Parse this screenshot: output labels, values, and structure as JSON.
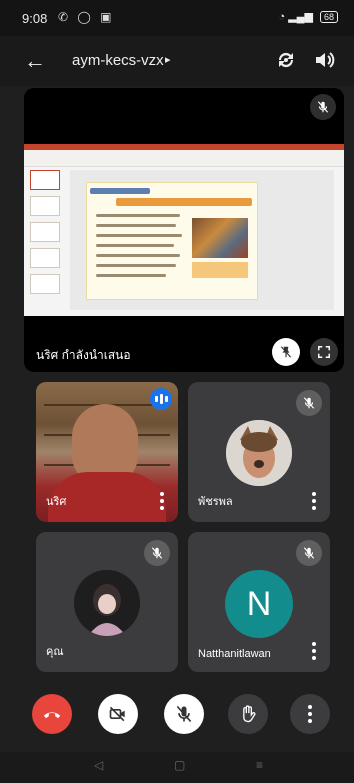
{
  "status_bar": {
    "time": "9:08",
    "battery": "68"
  },
  "header": {
    "meeting_code": "aym-kecs-vzx",
    "caret": "▸"
  },
  "presentation": {
    "presenter_label": "นริศ กำลังนำเสนอ"
  },
  "participants": [
    {
      "name": "นริศ",
      "type": "video",
      "speaking": true
    },
    {
      "name": "พัชรพล",
      "type": "photo",
      "muted": true
    },
    {
      "name": "คุณ",
      "type": "photo",
      "muted": true
    },
    {
      "name": "Natthanitlawan",
      "type": "initial",
      "initial": "N",
      "muted": true
    }
  ],
  "controls": [
    "end-call",
    "camera-off",
    "mic-off",
    "raise-hand",
    "more-options"
  ],
  "colors": {
    "end_call": "#e8453c",
    "avatar_teal": "#128c8c",
    "speaking_blue": "#1a73e8",
    "tile_bg": "#3c3c3e"
  }
}
